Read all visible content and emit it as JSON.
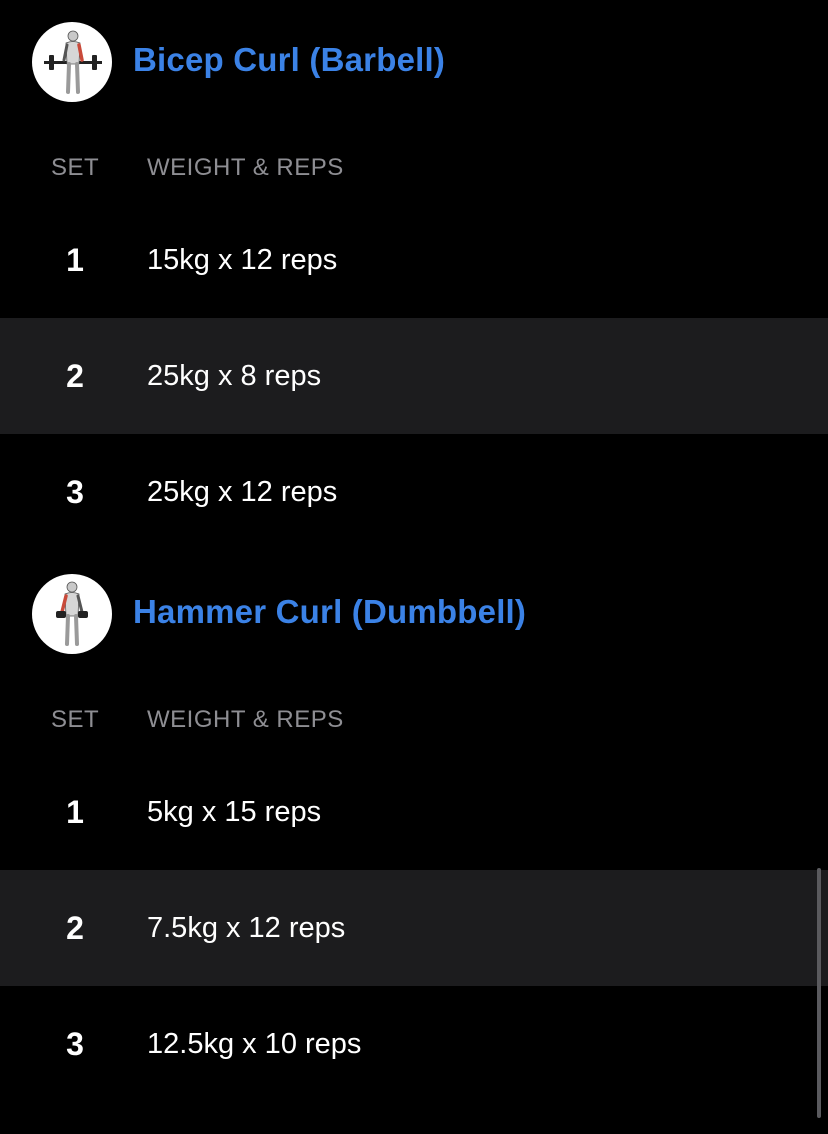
{
  "exercises": [
    {
      "name": "Bicep Curl (Barbell)",
      "icon": "bicep-curl-barbell-icon",
      "set_header": "SET",
      "weight_header": "WEIGHT & REPS",
      "sets": [
        {
          "number": "1",
          "value": "15kg x 12 reps"
        },
        {
          "number": "2",
          "value": "25kg x 8 reps"
        },
        {
          "number": "3",
          "value": "25kg x 12 reps"
        }
      ]
    },
    {
      "name": "Hammer Curl (Dumbbell)",
      "icon": "hammer-curl-dumbbell-icon",
      "set_header": "SET",
      "weight_header": "WEIGHT & REPS",
      "sets": [
        {
          "number": "1",
          "value": "5kg x 15 reps"
        },
        {
          "number": "2",
          "value": "7.5kg x 12 reps"
        },
        {
          "number": "3",
          "value": "12.5kg x 10 reps"
        }
      ]
    }
  ],
  "colors": {
    "background": "#000000",
    "title": "#3b82e6",
    "header_text": "#8e8e93",
    "alt_row": "#1c1c1e"
  }
}
